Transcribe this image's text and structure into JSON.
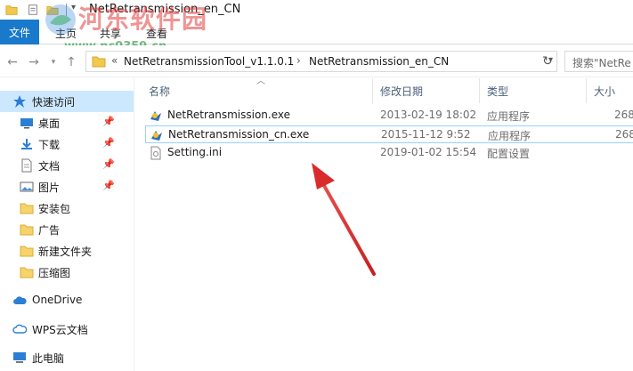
{
  "window": {
    "title": "NetRetransmission_en_CN"
  },
  "watermark": {
    "text": "河东软件园",
    "url": "www.pc0359.cn"
  },
  "ribbon": {
    "tabs": [
      {
        "label": "文件"
      },
      {
        "label": "主页"
      },
      {
        "label": "共享"
      },
      {
        "label": "查看"
      }
    ]
  },
  "address": {
    "overflow": "«",
    "crumbs": [
      {
        "label": "NetRetransmissionTool_v1.1.0.1"
      },
      {
        "label": "NetRetransmission_en_CN"
      }
    ],
    "separator": "›"
  },
  "search": {
    "placeholder": "搜索\"NetRe"
  },
  "navpane": {
    "items": [
      {
        "label": "快速访问",
        "icon": "star-icon",
        "pinned": false
      },
      {
        "label": "桌面",
        "icon": "desktop-icon",
        "pinned": true
      },
      {
        "label": "下载",
        "icon": "download-icon",
        "pinned": true
      },
      {
        "label": "文档",
        "icon": "document-icon",
        "pinned": true
      },
      {
        "label": "图片",
        "icon": "pictures-icon",
        "pinned": true
      },
      {
        "label": "安装包",
        "icon": "folder-icon",
        "pinned": false
      },
      {
        "label": "广告",
        "icon": "folder-icon",
        "pinned": false
      },
      {
        "label": "新建文件夹",
        "icon": "folder-icon",
        "pinned": false
      },
      {
        "label": "压缩图",
        "icon": "folder-icon",
        "pinned": false
      },
      {
        "label": "OneDrive",
        "icon": "cloud-icon",
        "pinned": false
      },
      {
        "label": "WPS云文档",
        "icon": "cloud-icon",
        "pinned": false
      },
      {
        "label": "此电脑",
        "icon": "computer-icon",
        "pinned": false
      }
    ]
  },
  "columns": {
    "name": "名称",
    "date": "修改日期",
    "type": "类型",
    "size": "大小"
  },
  "files": [
    {
      "name": "NetRetransmission.exe",
      "date": "2013-02-19 18:02",
      "type": "应用程序",
      "size": "268",
      "icon": "exe-icon"
    },
    {
      "name": "NetRetransmission_cn.exe",
      "date": "2015-11-12 9:52",
      "type": "应用程序",
      "size": "268",
      "icon": "exe-icon"
    },
    {
      "name": "Setting.ini",
      "date": "2019-01-02 15:54",
      "type": "配置设置",
      "size": "",
      "icon": "ini-file-icon"
    }
  ],
  "colors": {
    "accent": "#1979ca",
    "selection": "#cce8ff",
    "annotation_arrow": "#e23a3a"
  }
}
